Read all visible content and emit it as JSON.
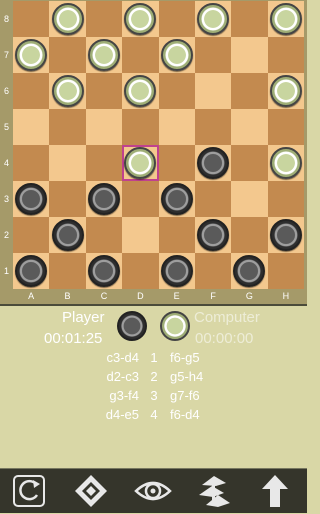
{
  "board": {
    "ranks": [
      "8",
      "7",
      "6",
      "5",
      "4",
      "3",
      "2",
      "1"
    ],
    "files": [
      "A",
      "B",
      "C",
      "D",
      "E",
      "F",
      "G",
      "H"
    ],
    "highlight": "d4",
    "pieces": [
      {
        "sq": "b8",
        "color": "white"
      },
      {
        "sq": "d8",
        "color": "white"
      },
      {
        "sq": "f8",
        "color": "white"
      },
      {
        "sq": "h8",
        "color": "white"
      },
      {
        "sq": "a7",
        "color": "white"
      },
      {
        "sq": "c7",
        "color": "white"
      },
      {
        "sq": "e7",
        "color": "white"
      },
      {
        "sq": "b6",
        "color": "white"
      },
      {
        "sq": "d6",
        "color": "white"
      },
      {
        "sq": "h6",
        "color": "white"
      },
      {
        "sq": "d4",
        "color": "white"
      },
      {
        "sq": "f4",
        "color": "black"
      },
      {
        "sq": "h4",
        "color": "white"
      },
      {
        "sq": "a3",
        "color": "black"
      },
      {
        "sq": "c3",
        "color": "black"
      },
      {
        "sq": "e3",
        "color": "black"
      },
      {
        "sq": "b2",
        "color": "black"
      },
      {
        "sq": "f2",
        "color": "black"
      },
      {
        "sq": "h2",
        "color": "black"
      },
      {
        "sq": "a1",
        "color": "black"
      },
      {
        "sq": "c1",
        "color": "black"
      },
      {
        "sq": "e1",
        "color": "black"
      },
      {
        "sq": "g1",
        "color": "black"
      }
    ],
    "colors": {
      "light": "#f3c88e",
      "dark": "#c38a4f",
      "highlight": "#c0418e"
    }
  },
  "player": {
    "name": "Player",
    "clock": "00:01:25"
  },
  "computer": {
    "name": "Computer",
    "clock": "00:00:00"
  },
  "moves": [
    {
      "n": "1",
      "white": "c3-d4",
      "black": "f6-g5"
    },
    {
      "n": "2",
      "white": "d2-c3",
      "black": "g5-h4"
    },
    {
      "n": "3",
      "white": "g3-f4",
      "black": "g7-f6"
    },
    {
      "n": "4",
      "white": "d4-e5",
      "black": "f6-d4"
    }
  ],
  "toolbar": {
    "buttons": [
      {
        "icon": "rotate-board-icon"
      },
      {
        "icon": "diamond-icon"
      },
      {
        "icon": "eye-icon"
      },
      {
        "icon": "tree-icon"
      },
      {
        "icon": "up-arrow-icon"
      }
    ]
  }
}
